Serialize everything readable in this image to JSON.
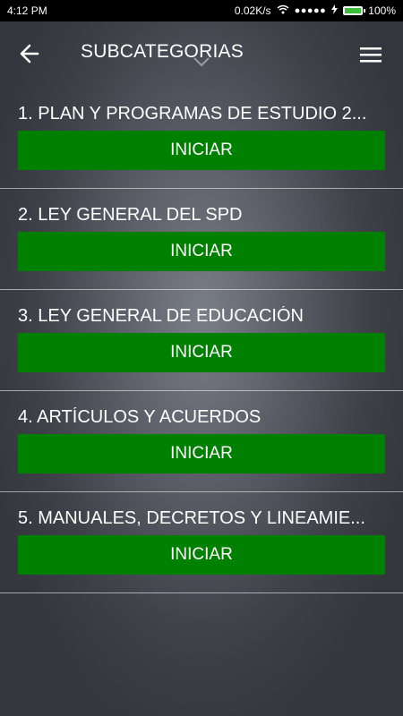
{
  "status_bar": {
    "time": "4:12 PM",
    "network_speed": "0.02K/s",
    "signal_dots": "●●●●●",
    "battery_percent": "100%",
    "battery_level": 1.0
  },
  "app_bar": {
    "title": "SUBCATEGORIAS",
    "back_icon": "arrow-left-icon",
    "menu_icon": "hamburger-menu-icon",
    "dropdown_icon": "chevron-down-icon"
  },
  "subcategories": [
    {
      "title": "1. PLAN Y PROGRAMAS DE ESTUDIO 2...",
      "button": "INICIAR"
    },
    {
      "title": "2. LEY GENERAL DEL SPD",
      "button": "INICIAR"
    },
    {
      "title": "3. LEY GENERAL DE EDUCACIÓN",
      "button": "INICIAR"
    },
    {
      "title": "4. ARTÍCULOS Y ACUERDOS",
      "button": "INICIAR"
    },
    {
      "title": "5. MANUALES, DECRETOS Y LINEAMIE...",
      "button": "INICIAR"
    }
  ],
  "colors": {
    "button_green": "#008000",
    "statusbar_bg": "#000000"
  }
}
